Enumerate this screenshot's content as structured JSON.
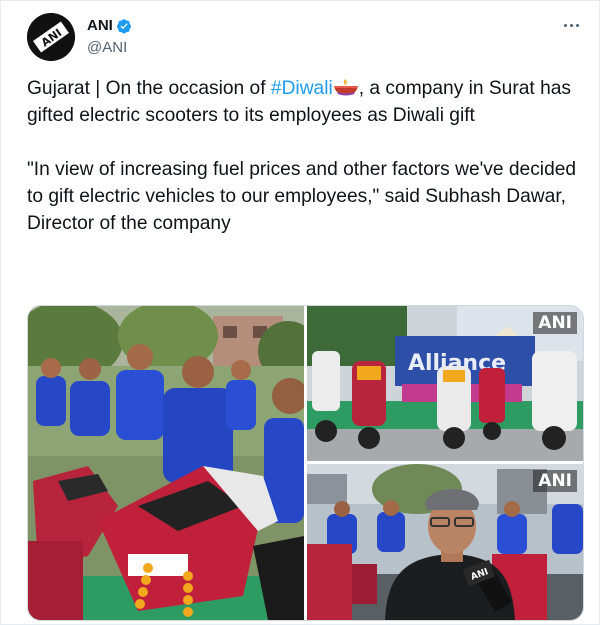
{
  "author": {
    "display_name": "ANI",
    "handle": "@ANI",
    "verified": true,
    "avatar_icon": "ani-logo"
  },
  "tweet": {
    "para1_before": "Gujarat | On the occasion of ",
    "hashtag": "#Diwali",
    "emoji_icon": "diya-lamp-icon",
    "para1_after": ", a company in Surat has gifted electric scooters to its employees as Diwali gift",
    "para2": "\"In view of increasing fuel prices and other factors we've decided to gift electric vehicles to our employees,\" said Subhash Dawar, Director of the company"
  },
  "media": {
    "watermark_top": "ANI",
    "watermark_bottom": "ANI"
  },
  "colors": {
    "link": "#1d9bf0",
    "secondary_text": "#536471",
    "shirt_blue": "#2647c8",
    "scooter_red": "#c0203a"
  }
}
